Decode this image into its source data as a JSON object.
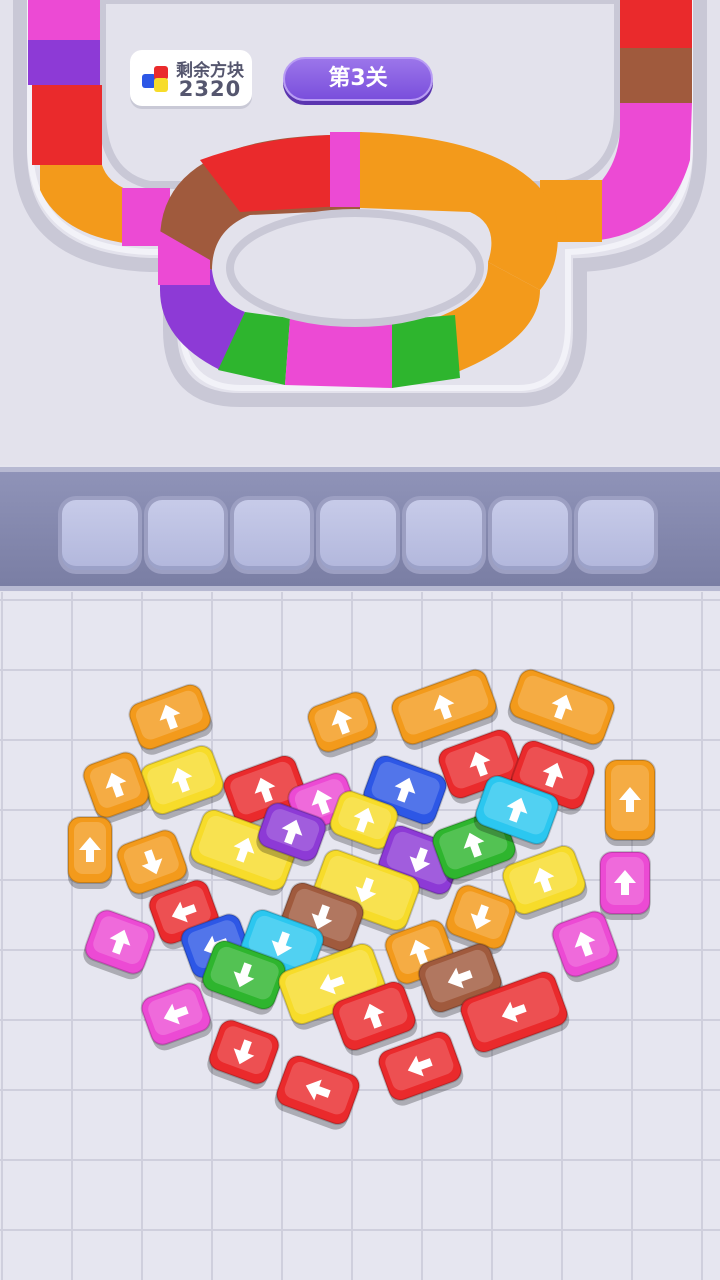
{
  "hud": {
    "remaining_label": "剩余方块",
    "remaining_count": "2320",
    "level_label": "第3关"
  },
  "colors": {
    "orange": "#f39a1b",
    "yellow": "#f7dc2a",
    "red": "#ea2a2c",
    "pink": "#ec4ad4",
    "purple": "#8d3ad6",
    "blue": "#2d57e6",
    "cyan": "#2bc7f0",
    "green": "#2eb52e",
    "brown": "#a05a3d"
  },
  "slots": [
    {
      "filled": false
    },
    {
      "filled": false
    },
    {
      "filled": false
    },
    {
      "filled": false
    },
    {
      "filled": false
    },
    {
      "filled": false
    },
    {
      "filled": false
    }
  ],
  "track_segments": [
    "red",
    "orange",
    "pink",
    "brown",
    "red",
    "pink",
    "orange",
    "purple",
    "green",
    "pink",
    "green",
    "orange"
  ],
  "cars": [
    {
      "color": "orange",
      "dir": "up"
    },
    {
      "color": "orange",
      "dir": "up"
    },
    {
      "color": "orange",
      "dir": "up"
    },
    {
      "color": "orange",
      "dir": "up"
    },
    {
      "color": "orange",
      "dir": "up"
    },
    {
      "color": "yellow",
      "dir": "up"
    },
    {
      "color": "red",
      "dir": "up"
    },
    {
      "color": "pink",
      "dir": "up"
    },
    {
      "color": "blue",
      "dir": "up"
    },
    {
      "color": "red",
      "dir": "up"
    },
    {
      "color": "red",
      "dir": "up"
    },
    {
      "color": "orange",
      "dir": "up"
    },
    {
      "color": "orange",
      "dir": "up"
    },
    {
      "color": "orange",
      "dir": "down"
    },
    {
      "color": "yellow",
      "dir": "up"
    },
    {
      "color": "purple",
      "dir": "up"
    },
    {
      "color": "yellow",
      "dir": "up"
    },
    {
      "color": "purple",
      "dir": "down"
    },
    {
      "color": "green",
      "dir": "up"
    },
    {
      "color": "cyan",
      "dir": "up"
    },
    {
      "color": "yellow",
      "dir": "up"
    },
    {
      "color": "pink",
      "dir": "up"
    },
    {
      "color": "red",
      "dir": "left"
    },
    {
      "color": "yellow",
      "dir": "down"
    },
    {
      "color": "brown",
      "dir": "down"
    },
    {
      "color": "orange",
      "dir": "down"
    },
    {
      "color": "blue",
      "dir": "left"
    },
    {
      "color": "cyan",
      "dir": "down"
    },
    {
      "color": "pink",
      "dir": "up"
    },
    {
      "color": "green",
      "dir": "down"
    },
    {
      "color": "yellow",
      "dir": "left"
    },
    {
      "color": "orange",
      "dir": "up"
    },
    {
      "color": "brown",
      "dir": "left"
    },
    {
      "color": "red",
      "dir": "left"
    },
    {
      "color": "pink",
      "dir": "up"
    },
    {
      "color": "pink",
      "dir": "left"
    },
    {
      "color": "red",
      "dir": "up"
    },
    {
      "color": "red",
      "dir": "down"
    },
    {
      "color": "red",
      "dir": "left"
    },
    {
      "color": "red",
      "dir": "left"
    }
  ]
}
